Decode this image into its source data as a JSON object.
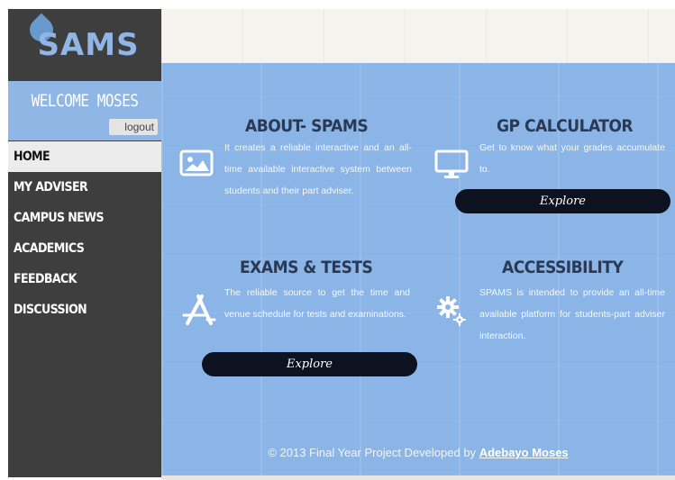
{
  "app": {
    "logo_text": "SAMS"
  },
  "sidebar": {
    "welcome": "WELCOME MOSES",
    "logout_label": "logout",
    "items": [
      {
        "label": "HOME",
        "active": true
      },
      {
        "label": "MY ADVISER",
        "active": false
      },
      {
        "label": "CAMPUS NEWS",
        "active": false
      },
      {
        "label": "ACADEMICS",
        "active": false
      },
      {
        "label": "FEEDBACK",
        "active": false
      },
      {
        "label": "DISCUSSION",
        "active": false
      }
    ]
  },
  "cards": {
    "about": {
      "title": "ABOUT- SPAMS",
      "text": "It creates a reliable interactive and an all-time available interactive system between students and their part adviser.",
      "icon": "image-icon"
    },
    "gp": {
      "title": "GP CALCULATOR",
      "text": "Get to know what your grades accumulate to.",
      "button": "Explore",
      "icon": "monitor-icon"
    },
    "exams": {
      "title": "EXAMS & TESTS",
      "text": "The reliable source to get the time and venue schedule for tests and examinations.",
      "button": "Explore",
      "icon": "app-store-icon"
    },
    "access": {
      "title": "ACCESSIBILITY",
      "text": "SPAMS is intended to provide an all-time available platform for students-part adviser interaction.",
      "icon": "gears-icon"
    }
  },
  "footer": {
    "text": "© 2013 Final Year Project Developed by",
    "author_link": "Adebayo Moses"
  },
  "colors": {
    "sidebar_bg": "#3e3e3e",
    "accent_blue": "#8bb5e6",
    "button_dark": "#0d1220",
    "heading": "#2a3a55"
  }
}
